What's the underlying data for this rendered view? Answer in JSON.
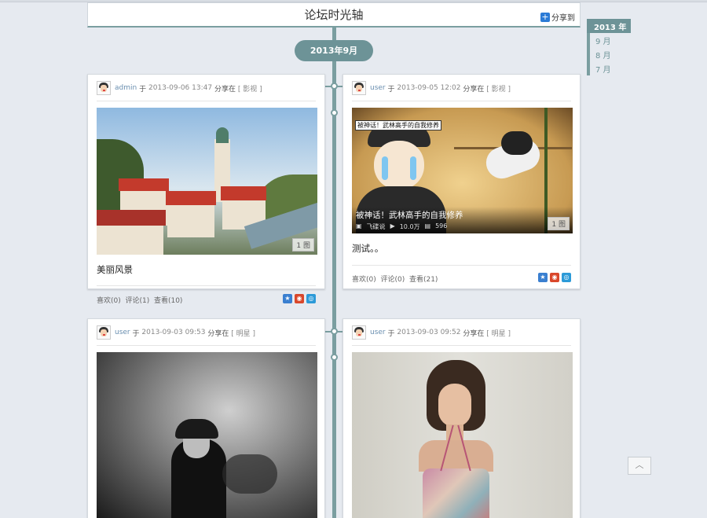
{
  "header": {
    "title": "论坛时光轴",
    "share_label": "分享到"
  },
  "timeline": {
    "month_label": "2013年9月"
  },
  "year_nav": {
    "year": "2013 年",
    "months": [
      "9 月",
      "8 月",
      "7 月"
    ]
  },
  "posts": [
    {
      "user": "admin",
      "text_in": "于",
      "time": "2013-09-06 13:47",
      "shared_in": "分享在",
      "category": "[ 影视 ]",
      "image_badge": "1 图",
      "caption": "美丽风景",
      "likes": "喜欢(0)",
      "comments": "评论(1)",
      "views": "查看(10)"
    },
    {
      "user": "user",
      "text_in": "于",
      "time": "2013-09-05 12:02",
      "shared_in": "分享在",
      "category": "[ 影视 ]",
      "image_badge": "1 图",
      "image_title": "被神话！武林高手的自我修养",
      "image_title_top": "被神话！武林高手的自我修养",
      "image_source": "飞碟说",
      "image_plays": "10.0万",
      "image_comments": "596",
      "caption": "测试。。",
      "likes": "喜欢(0)",
      "comments": "评论(0)",
      "views": "查看(21)"
    },
    {
      "user": "user",
      "text_in": "于",
      "time": "2013-09-03 09:53",
      "shared_in": "分享在",
      "category": "[ 明星 ]"
    },
    {
      "user": "user",
      "text_in": "于",
      "time": "2013-09-03 09:52",
      "shared_in": "分享在",
      "category": "[ 明星 ]"
    }
  ],
  "back_to_top": "︿",
  "colors": {
    "accent": "#6d9397",
    "spine": "#7a9ea0",
    "background": "#e6eaf0"
  }
}
